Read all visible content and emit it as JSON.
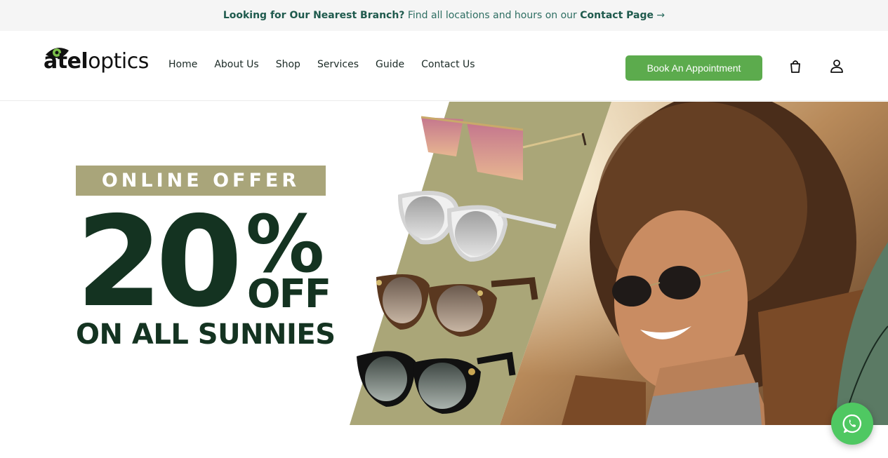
{
  "announcement": {
    "lead": "Looking for Our Nearest Branch?",
    "middle": " Find all locations and hours on our ",
    "link": "Contact Page",
    "arrow": " →"
  },
  "header": {
    "logo": {
      "bold": "atel",
      "light": "optics",
      "icon": "eye-logo-icon"
    },
    "nav": [
      "Home",
      "About Us",
      "Shop",
      "Services",
      "Guide",
      "Contact Us"
    ],
    "cta": "Book An Appointment",
    "icons": [
      "shopping-bag-icon",
      "user-account-icon"
    ]
  },
  "hero": {
    "tag": "ONLINE OFFER",
    "big_number": "20",
    "percent": "%",
    "off": "OFF",
    "subline": "ON ALL SUNNIES",
    "colors": {
      "tag_bg": "#a9a57a",
      "text": "#143321",
      "stripe": "#aaa678"
    }
  },
  "floating": {
    "icon": "whatsapp-icon",
    "color": "#4fc862"
  },
  "colors": {
    "accent": "#5cab4d",
    "topbar_bg": "#f5f5f5",
    "topbar_text": "#2e6e62"
  }
}
